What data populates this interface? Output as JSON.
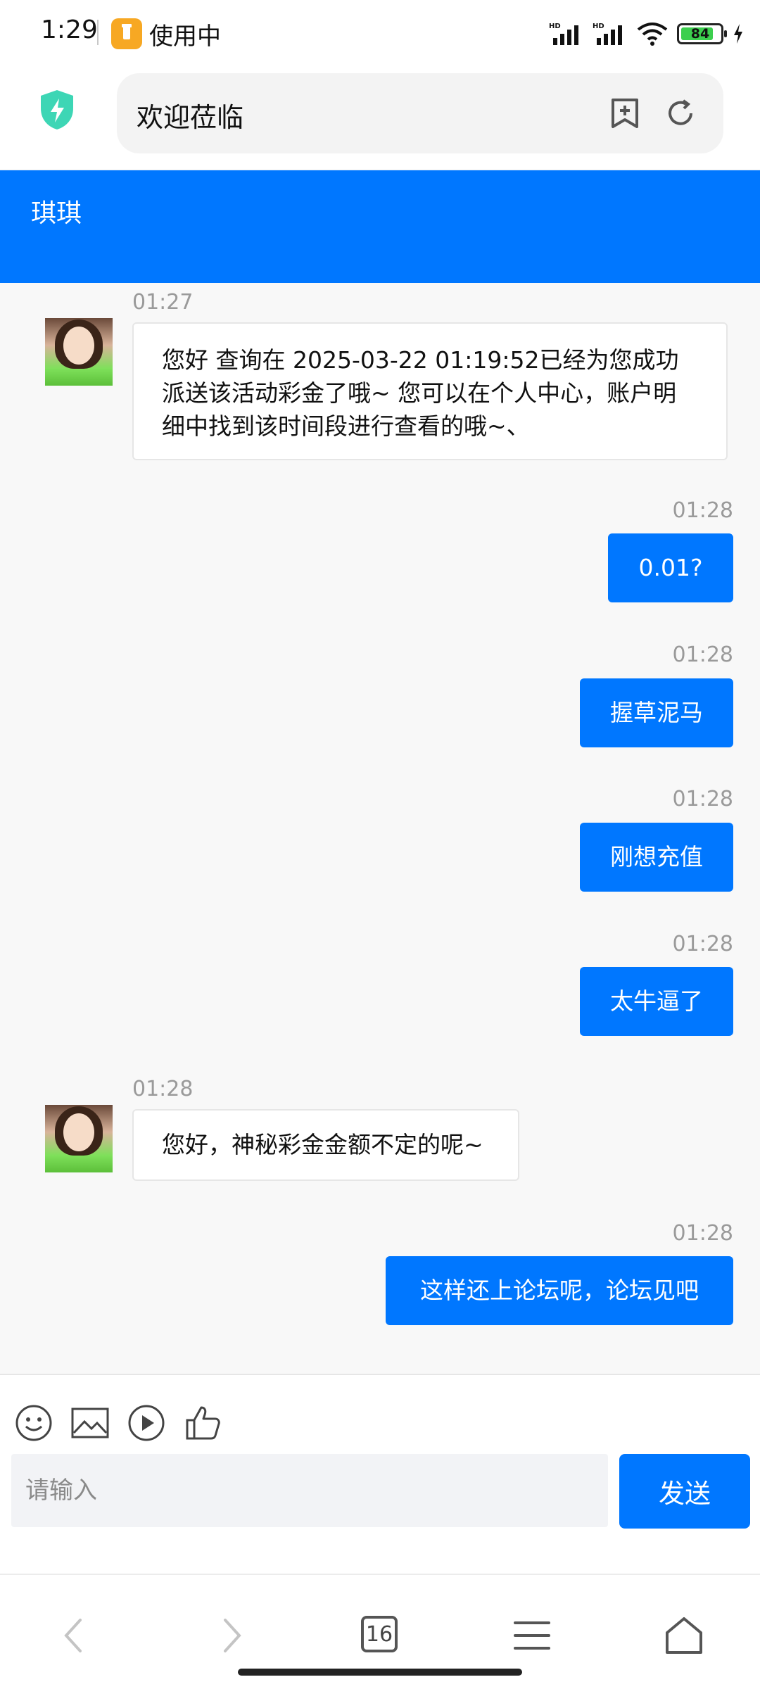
{
  "status_bar": {
    "time": "1:29",
    "app_label": "使用中",
    "battery": "84",
    "battery_level": 0.84,
    "icons": [
      "hd-signal-icon",
      "hd-signal-icon",
      "wifi-icon",
      "battery-icon",
      "charging-icon"
    ]
  },
  "browser": {
    "address": "欢迎莅临",
    "icons": [
      "shield-icon",
      "bookmark-add-icon",
      "reload-icon"
    ]
  },
  "chat": {
    "title": "琪琪",
    "messages": [
      {
        "side": "in",
        "time": "01:27",
        "text": [
          "您好 查询在 2025-03-22 01:19:52已经为您成功",
          "派送该活动彩金了哦~ 您可以在个人中心，账户明",
          "细中找到该时间段进行查看的哦~、"
        ]
      },
      {
        "side": "out",
        "time": "01:28",
        "text": "0.01?"
      },
      {
        "side": "out",
        "time": "01:28",
        "text": "握草泥马"
      },
      {
        "side": "out",
        "time": "01:28",
        "text": "刚想充值"
      },
      {
        "side": "out",
        "time": "01:28",
        "text": "太牛逼了"
      },
      {
        "side": "in",
        "time": "01:28",
        "text": "您好，神秘彩金金额不定的呢~"
      },
      {
        "side": "out",
        "time": "01:28",
        "text": "这样还上论坛呢，论坛见吧"
      }
    ]
  },
  "input": {
    "placeholder": "请输入",
    "send_label": "发送",
    "tools": [
      "emoji-icon",
      "image-icon",
      "video-icon",
      "thumbs-up-icon"
    ]
  },
  "bottom_nav": {
    "tab_count": "16",
    "icons": [
      "back-icon",
      "forward-icon",
      "tabs-icon",
      "menu-icon",
      "home-icon"
    ]
  },
  "colors": {
    "accent": "#0077ff",
    "background": "#f8f8f8",
    "timestamp": "#9a9a9a"
  }
}
